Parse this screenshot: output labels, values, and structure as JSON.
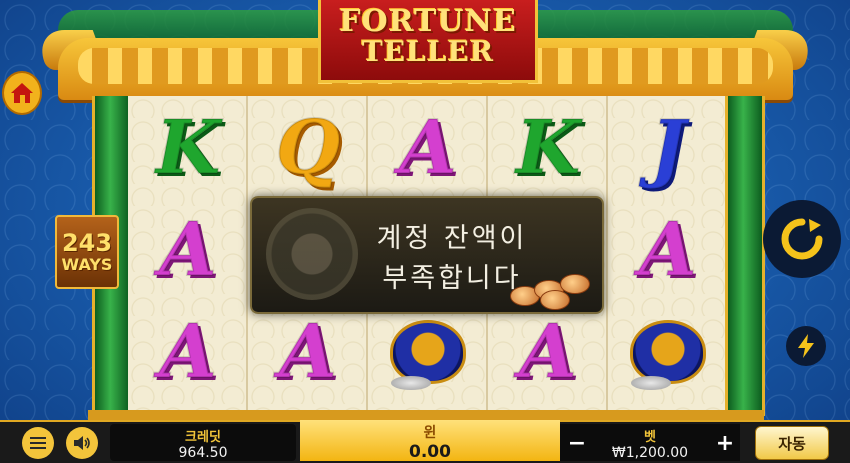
{
  "game": {
    "logo_line1": "FORTUNE",
    "logo_line2": "TELLER",
    "ways_number": "243",
    "ways_label": "WAYS"
  },
  "reels": [
    [
      "K",
      "A",
      "A"
    ],
    [
      "Q",
      "",
      "A"
    ],
    [
      "A",
      "",
      "drum"
    ],
    [
      "K",
      "",
      "A"
    ],
    [
      "J",
      "A",
      "drum"
    ]
  ],
  "symbol_colors": {
    "K": "#1fa62e",
    "Q": "#f2a812",
    "A": "#d43fcf",
    "J": "#2a3fd6"
  },
  "message": {
    "line1": "계정 잔액이",
    "line2": "부족합니다"
  },
  "bottom_bar": {
    "credit_label": "크레딧",
    "credit_value": "964.50",
    "win_label": "윈",
    "win_value": "0.00",
    "bet_label": "벳",
    "bet_value": "₩1,200.00",
    "minus": "−",
    "plus": "+",
    "auto_label": "자동"
  },
  "icons": {
    "home": "home-icon",
    "menu": "menu-icon",
    "sound": "speaker-icon",
    "spin": "spin-arrow-icon",
    "turbo": "lightning-icon"
  }
}
